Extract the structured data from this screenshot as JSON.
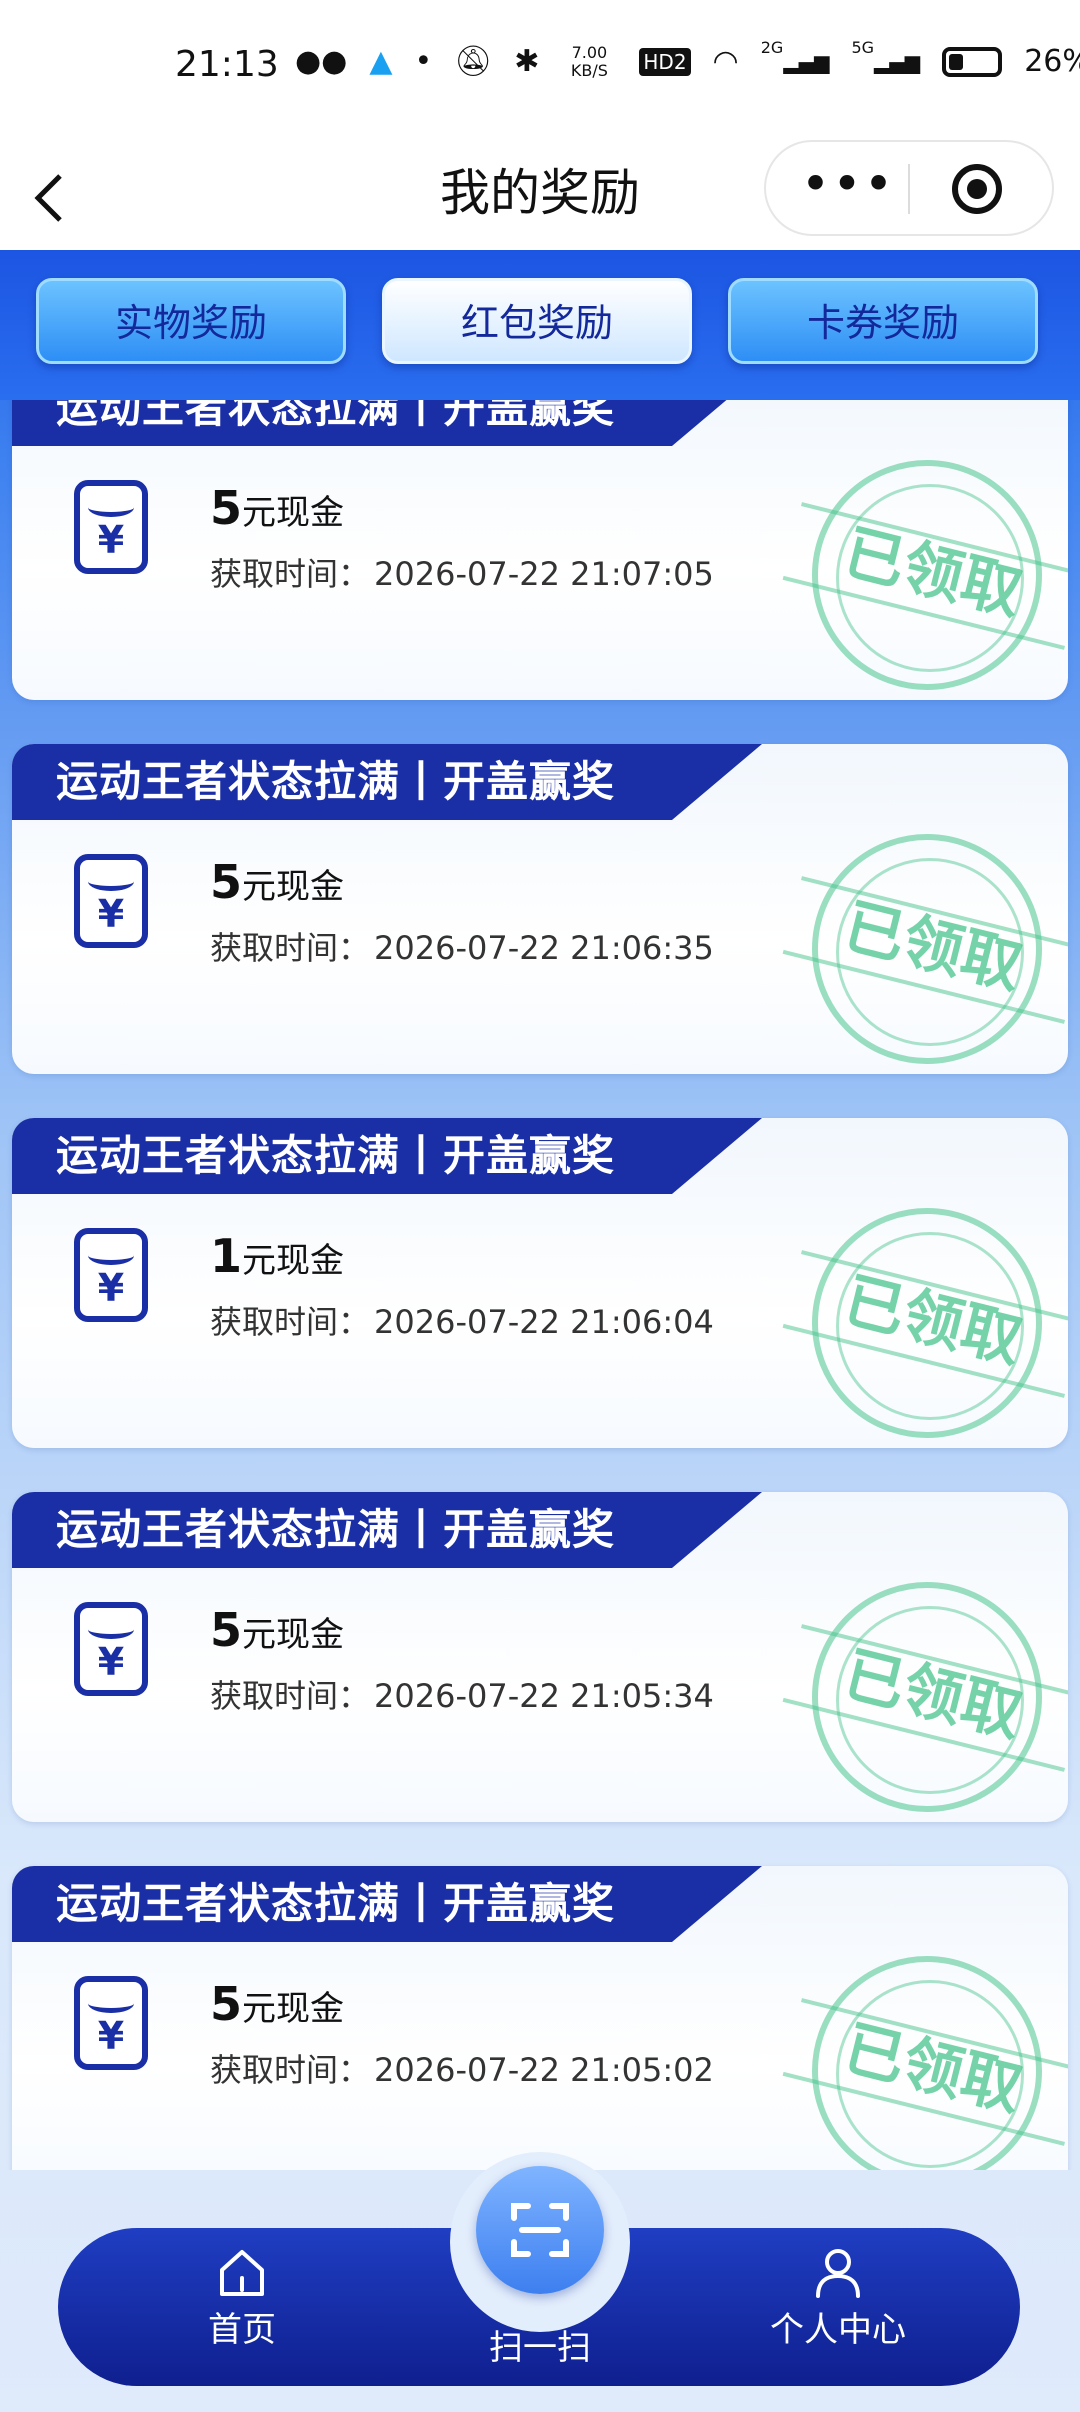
{
  "status_bar": {
    "time": "21:13",
    "icons": [
      "wechat-icon",
      "qq-icon",
      "dot-icon",
      "mute-icon",
      "bluetooth-icon",
      "data-speed",
      "hd-icon",
      "wifi-icon",
      "signal-2g-icon",
      "signal-5g-icon",
      "battery-icon"
    ],
    "net_speed": "7.00 KB/S",
    "hd_label": "HD2",
    "sig_2g_label": "2G",
    "sig_5g_label": "5G",
    "battery": "26%"
  },
  "nav": {
    "back_icon": "chevron-left-icon",
    "title": "我的奖励",
    "more_label": "•••"
  },
  "tabs": [
    {
      "label": "实物奖励",
      "active": false
    },
    {
      "label": "红包奖励",
      "active": true
    },
    {
      "label": "卡券奖励",
      "active": false
    }
  ],
  "cards": [
    {
      "banner": "运动王者状态拉满丨开盖赢奖",
      "amount": "5",
      "amount_unit": "元现金",
      "time_label": "获取时间：",
      "time": "2026-07-22 21:07:05",
      "stamp": "已领取"
    },
    {
      "banner": "运动王者状态拉满丨开盖赢奖",
      "amount": "5",
      "amount_unit": "元现金",
      "time_label": "获取时间：",
      "time": "2026-07-22 21:06:35",
      "stamp": "已领取"
    },
    {
      "banner": "运动王者状态拉满丨开盖赢奖",
      "amount": "1",
      "amount_unit": "元现金",
      "time_label": "获取时间：",
      "time": "2026-07-22 21:06:04",
      "stamp": "已领取"
    },
    {
      "banner": "运动王者状态拉满丨开盖赢奖",
      "amount": "5",
      "amount_unit": "元现金",
      "time_label": "获取时间：",
      "time": "2026-07-22 21:05:34",
      "stamp": "已领取"
    },
    {
      "banner": "运动王者状态拉满丨开盖赢奖",
      "amount": "5",
      "amount_unit": "元现金",
      "time_label": "获取时间：",
      "time": "2026-07-22 21:05:02",
      "stamp": "已领取"
    }
  ],
  "red_packet_glyph": "¥",
  "bottom_nav": {
    "home_label": "首页",
    "scan_label": "扫一扫",
    "profile_label": "个人中心"
  },
  "colors": {
    "primary_blue": "#1a2ea6",
    "header_blue": "#1f61e8",
    "stamp_green": "#48c48c"
  }
}
